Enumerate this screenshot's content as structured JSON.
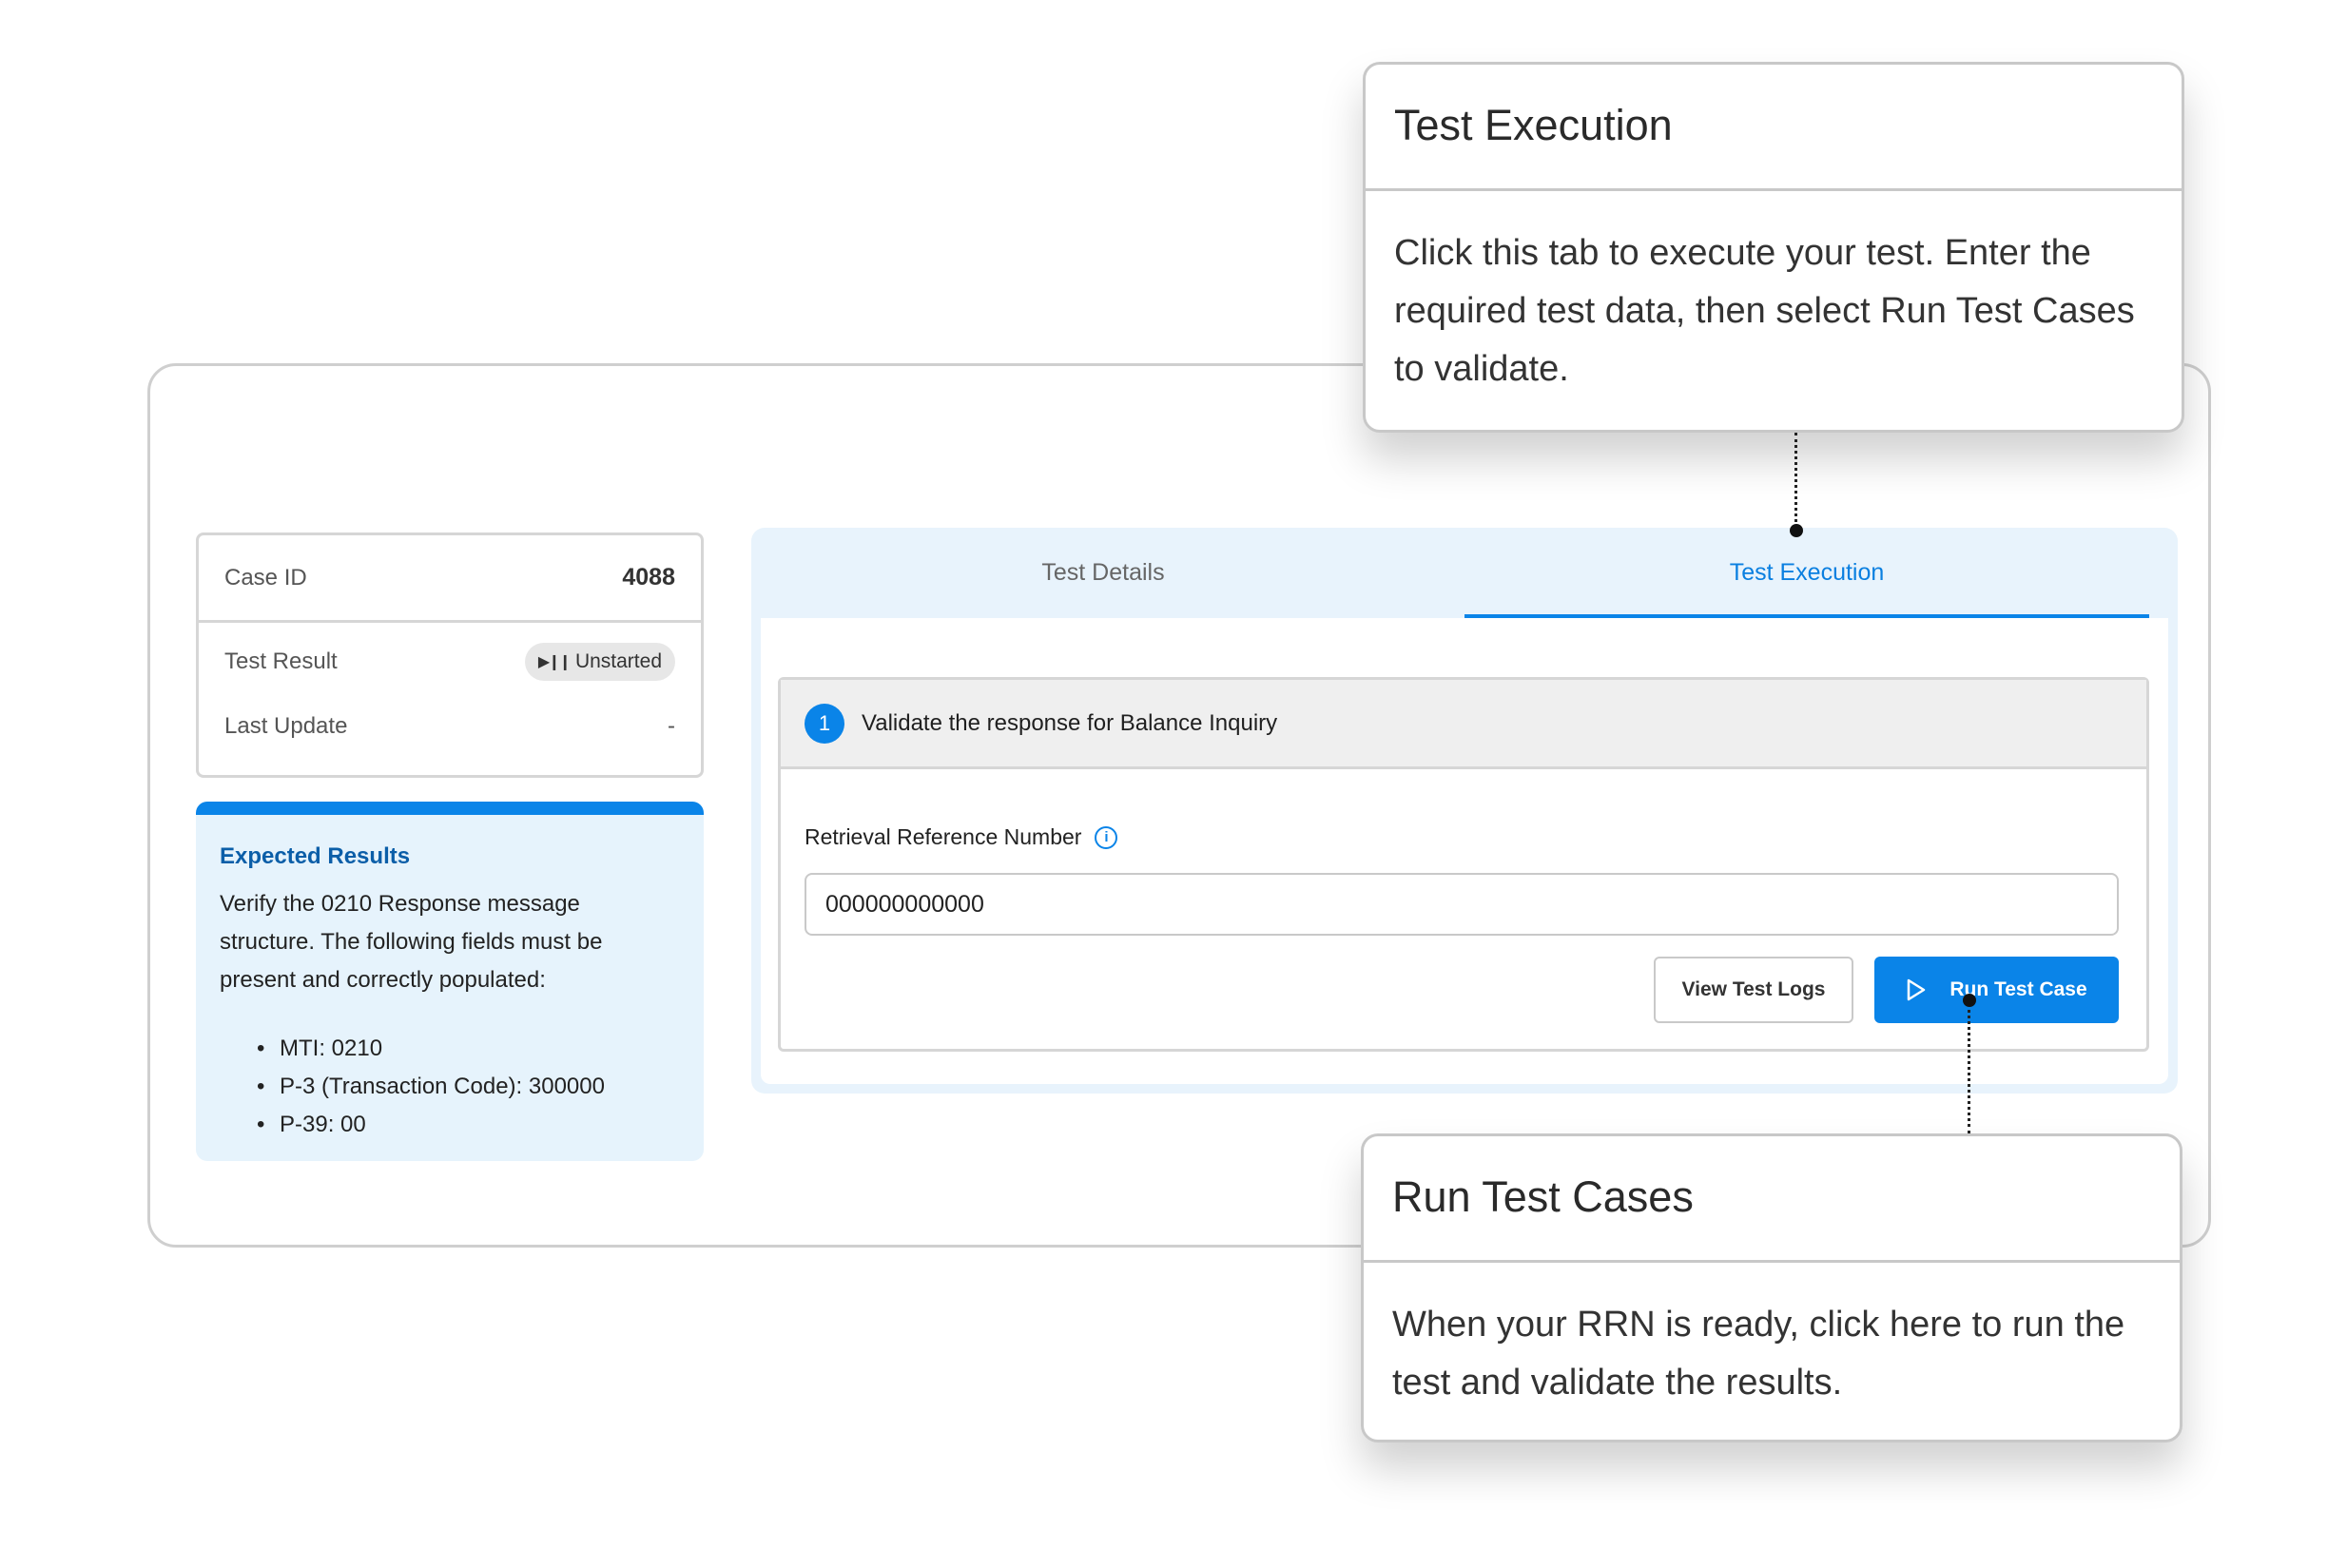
{
  "case_info": {
    "case_id_label": "Case ID",
    "case_id_value": "4088",
    "test_result_label": "Test Result",
    "test_result_value": "Unstarted",
    "last_update_label": "Last Update",
    "last_update_value": "-"
  },
  "expected_results": {
    "title": "Expected Results",
    "description": "Verify the 0210 Response message structure. The following fields must be present and correctly populated:",
    "items": [
      "MTI: 0210",
      "P-3 (Transaction Code): 300000",
      "P-39: 00"
    ]
  },
  "tabs": {
    "details": "Test Details",
    "execution": "Test Execution",
    "active": "execution"
  },
  "step": {
    "number": "1",
    "title": "Validate the response for Balance Inquiry",
    "field_label": "Retrieval Reference Number",
    "field_value": "000000000000",
    "view_logs_label": "View Test Logs",
    "run_label": "Run Test Case"
  },
  "tooltips": {
    "execution": {
      "title": "Test Execution",
      "body": "Click this tab to execute your test. Enter the required test data, then select Run Test Cases to validate."
    },
    "run": {
      "title": "Run Test Cases",
      "body": "When your RRN is ready, click here to run the test and validate the results."
    }
  },
  "colors": {
    "accent": "#0a84e8",
    "panel_bg": "#e8f3fc",
    "expected_bg": "#e6f3fc"
  },
  "icons": {
    "status": "play-pause-icon",
    "info": "info-icon",
    "run": "play-icon"
  }
}
